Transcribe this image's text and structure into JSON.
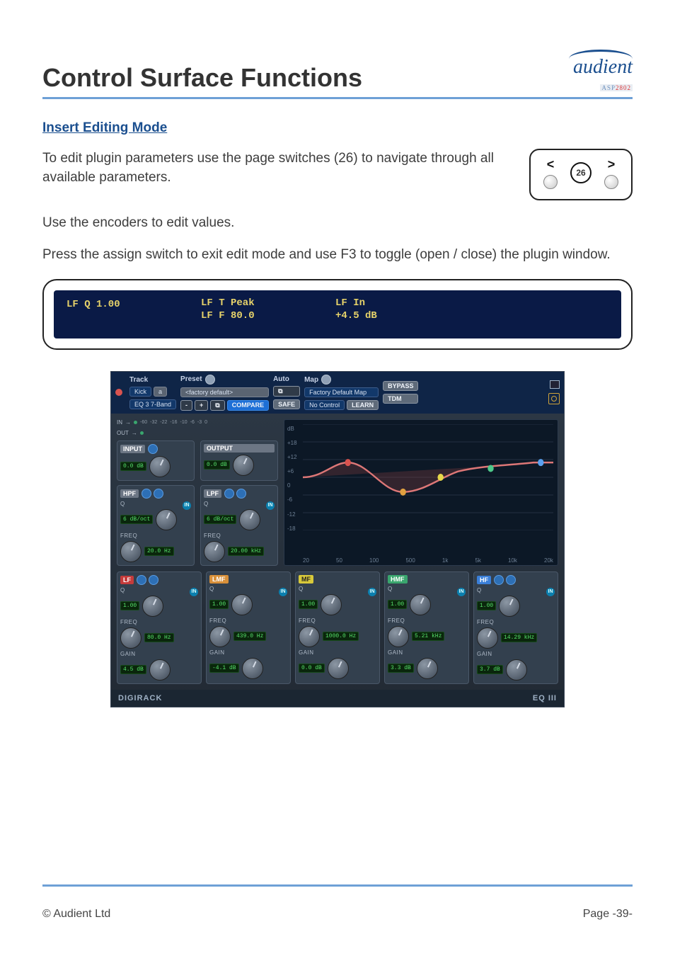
{
  "header": {
    "title": "Control Surface Functions",
    "brand": "audient",
    "brand_sub_prefix": "ASP",
    "brand_sub_suffix": "2802"
  },
  "section_heading": "Insert Editing Mode",
  "paragraphs": {
    "p1": "To edit plugin parameters use the page switches (26) to navigate through all available parameters.",
    "p2": "Use the encoders to edit values.",
    "p3": "Press the assign switch to exit edit mode and use F3 to toggle (open / close) the plugin window."
  },
  "nav": {
    "left": "<",
    "num": "26",
    "right": ">"
  },
  "lcd": {
    "c0": {
      "l1": "",
      "l2": "LF Q 1.00"
    },
    "c1": {
      "l1": "LF T Peak",
      "l2": "LF F 80.0"
    },
    "c2": {
      "l1": "LF In",
      "l2": "+4.5 dB"
    }
  },
  "plugin": {
    "toolbar": {
      "track_label": "Track",
      "track_value": "Kick",
      "track_sub": "a",
      "insert_value": "EQ 3 7-Band",
      "preset_label": "Preset",
      "preset_value": "<factory default>",
      "compare": "COMPARE",
      "auto_label": "Auto",
      "safe": "SAFE",
      "map_label": "Map",
      "map_value": "Factory Default Map",
      "no_control": "No Control",
      "learn": "LEARN",
      "bypass": "BYPASS",
      "tdm": "TDM"
    },
    "io": {
      "in_label": "IN",
      "out_label": "OUT",
      "scale": [
        "-60",
        "-32",
        "-22",
        "-16",
        "-10",
        "-6",
        "-3",
        "0"
      ],
      "input_title": "INPUT",
      "input_value": "0.0 dB",
      "output_title": "OUTPUT",
      "output_value": "0.0 dB"
    },
    "filters": {
      "hpf": {
        "title": "HPF",
        "q_label": "Q",
        "slope": "6 dB/oct",
        "freq_label": "FREQ",
        "freq": "20.0 Hz"
      },
      "lpf": {
        "title": "LPF",
        "q_label": "Q",
        "slope": "6 dB/oct",
        "freq_label": "FREQ",
        "freq": "20.00 kHz"
      }
    },
    "graph": {
      "y": [
        "dB",
        "+18",
        "+12",
        "+6",
        "0",
        "-6",
        "-12",
        "-18"
      ],
      "x": [
        "20",
        "50",
        "100",
        "500",
        "1k",
        "5k",
        "10k",
        "20k"
      ]
    },
    "bands": [
      {
        "title": "LF",
        "cls": "t-red",
        "q_label": "Q",
        "q": "1.00",
        "freq_label": "FREQ",
        "freq": "80.0 Hz",
        "gain_label": "GAIN",
        "gain": "4.5 dB"
      },
      {
        "title": "LMF",
        "cls": "t-orange",
        "q_label": "Q",
        "q": "1.00",
        "freq_label": "FREQ",
        "freq": "439.0 Hz",
        "gain_label": "GAIN",
        "gain": "-4.1 dB"
      },
      {
        "title": "MF",
        "cls": "t-yellow",
        "q_label": "Q",
        "q": "1.00",
        "freq_label": "FREQ",
        "freq": "1000.0 Hz",
        "gain_label": "GAIN",
        "gain": "0.0 dB"
      },
      {
        "title": "HMF",
        "cls": "t-green",
        "q_label": "Q",
        "q": "1.00",
        "freq_label": "FREQ",
        "freq": "5.21 kHz",
        "gain_label": "GAIN",
        "gain": "3.3 dB"
      },
      {
        "title": "HF",
        "cls": "t-blue",
        "q_label": "Q",
        "q": "1.00",
        "freq_label": "FREQ",
        "freq": "14.29 kHz",
        "gain_label": "GAIN",
        "gain": "3.7 dB"
      }
    ],
    "in_badge": "IN",
    "footer": {
      "left": "DIGIRACK",
      "right": "EQ III"
    }
  },
  "footer": {
    "copyright": "© Audient Ltd",
    "page": "Page -39-"
  }
}
